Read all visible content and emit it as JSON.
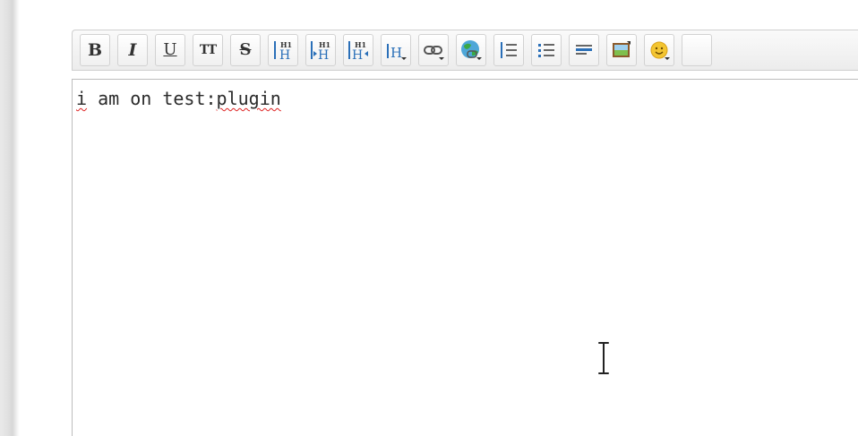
{
  "toolbar": {
    "buttons": [
      {
        "name": "bold-button",
        "glyph": "B",
        "icon": "bold-icon"
      },
      {
        "name": "italic-button",
        "glyph": "I",
        "icon": "italic-icon"
      },
      {
        "name": "underline-button",
        "glyph": "U",
        "icon": "underline-icon"
      },
      {
        "name": "monospace-button",
        "glyph": "TT",
        "icon": "monospace-icon"
      },
      {
        "name": "strikethrough-button",
        "glyph": "S",
        "icon": "strikethrough-icon"
      },
      {
        "name": "heading-same-level-button",
        "icon": "heading-same-icon"
      },
      {
        "name": "heading-lower-level-button",
        "icon": "heading-lower-icon"
      },
      {
        "name": "heading-higher-level-button",
        "icon": "heading-higher-icon"
      },
      {
        "name": "heading-select-button",
        "icon": "heading-select-icon"
      },
      {
        "name": "link-button",
        "icon": "link-icon"
      },
      {
        "name": "external-link-button",
        "icon": "globe-link-icon"
      },
      {
        "name": "ordered-list-button",
        "icon": "ordered-list-icon"
      },
      {
        "name": "unordered-list-button",
        "icon": "unordered-list-icon"
      },
      {
        "name": "horizontal-rule-button",
        "icon": "horizontal-rule-icon"
      },
      {
        "name": "media-button",
        "icon": "image-icon"
      },
      {
        "name": "smiley-button",
        "icon": "smiley-icon"
      }
    ]
  },
  "editor": {
    "text_before": "i am on test:",
    "text_misspelled": "plugin",
    "first_word_misspelled": "i"
  },
  "colors": {
    "heading_blue": "#2a6fb8",
    "spellcheck_red": "#dd2222"
  }
}
